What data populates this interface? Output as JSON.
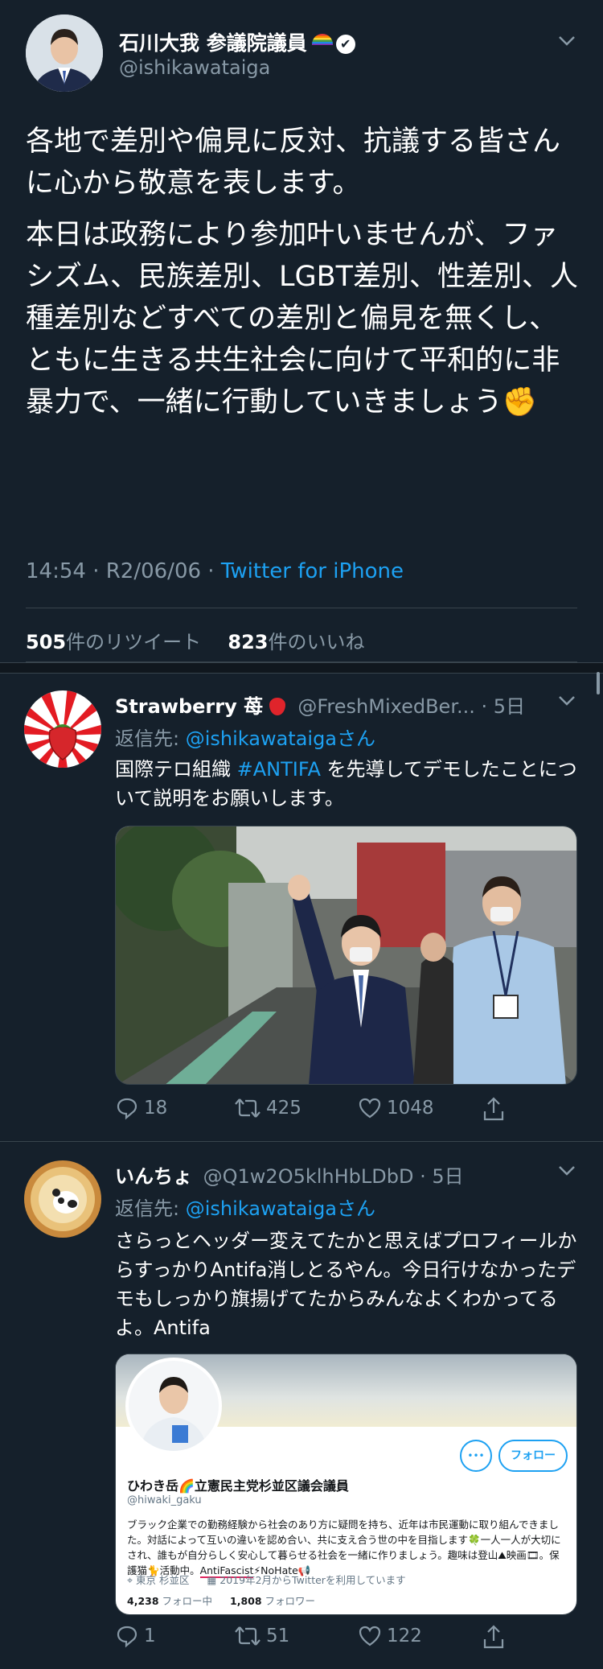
{
  "main_tweet": {
    "display_name": "石川大我 参議院議員",
    "handle": "@ishikawataiga",
    "paragraph1": "各地で差別や偏見に反対、抗議する皆さんに心から敬意を表します。",
    "paragraph2": "本日は政務により参加叶いませんが、ファシズム、民族差別、LGBT差別、性差別、人種差別などすべての差別と偏見を無くし、ともに生きる共生社会に向けて平和的に非暴力で、一緒に行動していきましょう",
    "fist_emoji": "✊",
    "time": "14:54",
    "date": "R2/06/06",
    "dot": "·",
    "source": "Twitter for iPhone",
    "retweets_count": "505",
    "retweets_label": "件のリツイート",
    "likes_count": "823",
    "likes_label": "件のいいね"
  },
  "replies": [
    {
      "display_name": "Strawberry 苺",
      "handle": "@FreshMixedBer...",
      "dot": "·",
      "age": "5日",
      "reply_prefix": "返信先: ",
      "reply_to": "@ishikawataigaさん",
      "text_before": "国際テロ組織 ",
      "hashtag": "#ANTIFA",
      "text_after": " を先導してデモしたことについて説明をお願いします。",
      "replies": "18",
      "retweets": "425",
      "likes": "1048"
    },
    {
      "display_name": "いんちょ",
      "handle": "@Q1w2O5klhHbLDbD",
      "dot": "·",
      "age": "5日",
      "reply_prefix": "返信先: ",
      "reply_to": "@ishikawataigaさん",
      "text": "さらっとヘッダー変えてたかと思えばプロフィールからすっかりAntifa消しとるやん。今日行けなかったデモもしっかり旗揚げてたからみんなよくわかってるよ。Antifa",
      "replies": "1",
      "retweets": "51",
      "likes": "122",
      "embedded_profile": {
        "follow_label": "フォロー",
        "name": "ひわき岳🌈立憲民主党杉並区議会議員",
        "handle": "@hiwaki_gaku",
        "bio": "ブラック企業での勤務経験から社会のあり方に疑問を持ち、近年は市民運動に取り組んできました。対話によって互いの違いを認め合い、共に支え合う世の中を目指します🍀一人一人が大切にされ、誰もが自分らしく安心して暮らせる社会を一緒に作りましょう。趣味は登山⛰映画🎞。保護猫🐈活動中。",
        "bio_highlight": "AntiFascist",
        "bio_tail": "⚡NoHate📢",
        "location": "東京 杉並区",
        "joined": "2019年2月からTwitterを利用しています",
        "following_count": "4,238",
        "following_label": " フォロー中",
        "followers_count": "1,808",
        "followers_label": " フォロワー"
      }
    }
  ],
  "colors": {
    "background": "#15202b",
    "accent": "#1da1f2",
    "muted": "#8899a6",
    "divider": "#38444d"
  }
}
